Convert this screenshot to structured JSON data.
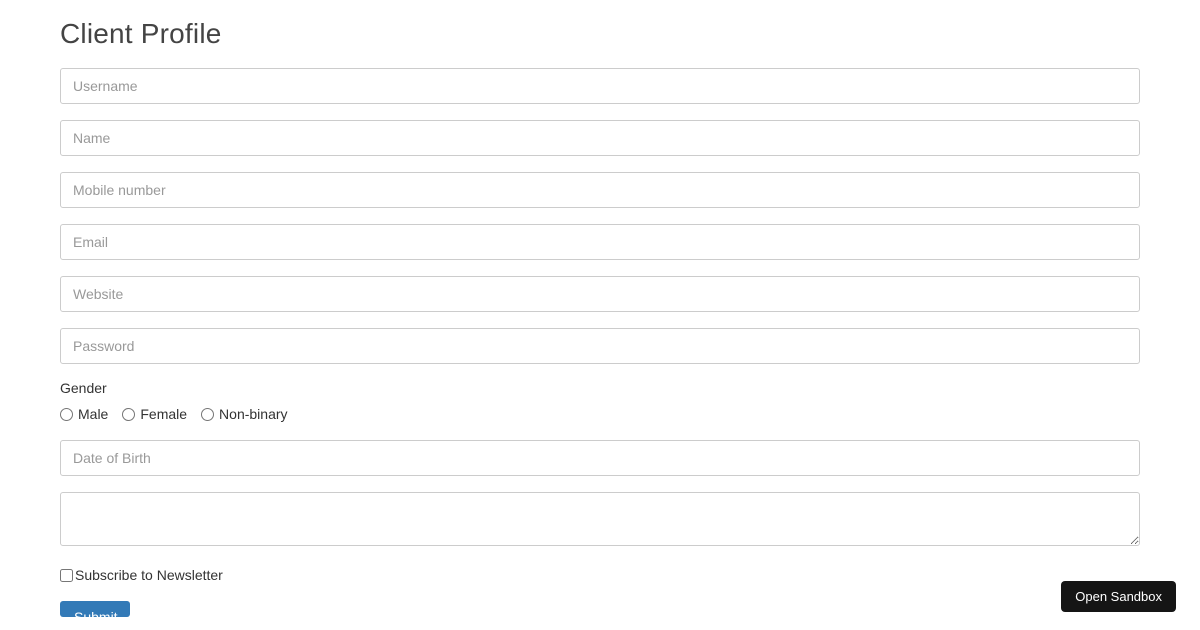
{
  "page": {
    "title": "Client Profile"
  },
  "form": {
    "username": {
      "placeholder": "Username",
      "value": ""
    },
    "name": {
      "placeholder": "Name",
      "value": ""
    },
    "mobile": {
      "placeholder": "Mobile number",
      "value": ""
    },
    "email": {
      "placeholder": "Email",
      "value": ""
    },
    "website": {
      "placeholder": "Website",
      "value": ""
    },
    "password": {
      "placeholder": "Password",
      "value": ""
    },
    "gender": {
      "label": "Gender",
      "options": [
        {
          "label": "Male"
        },
        {
          "label": "Female"
        },
        {
          "label": "Non-binary"
        }
      ]
    },
    "dob": {
      "placeholder": "Date of Birth",
      "value": ""
    },
    "address": {
      "placeholder": "",
      "value": ""
    },
    "newsletter": {
      "label": "Subscribe to Newsletter",
      "checked": false
    },
    "submit": {
      "label": "Submit"
    }
  },
  "sandbox": {
    "label": "Open Sandbox"
  }
}
